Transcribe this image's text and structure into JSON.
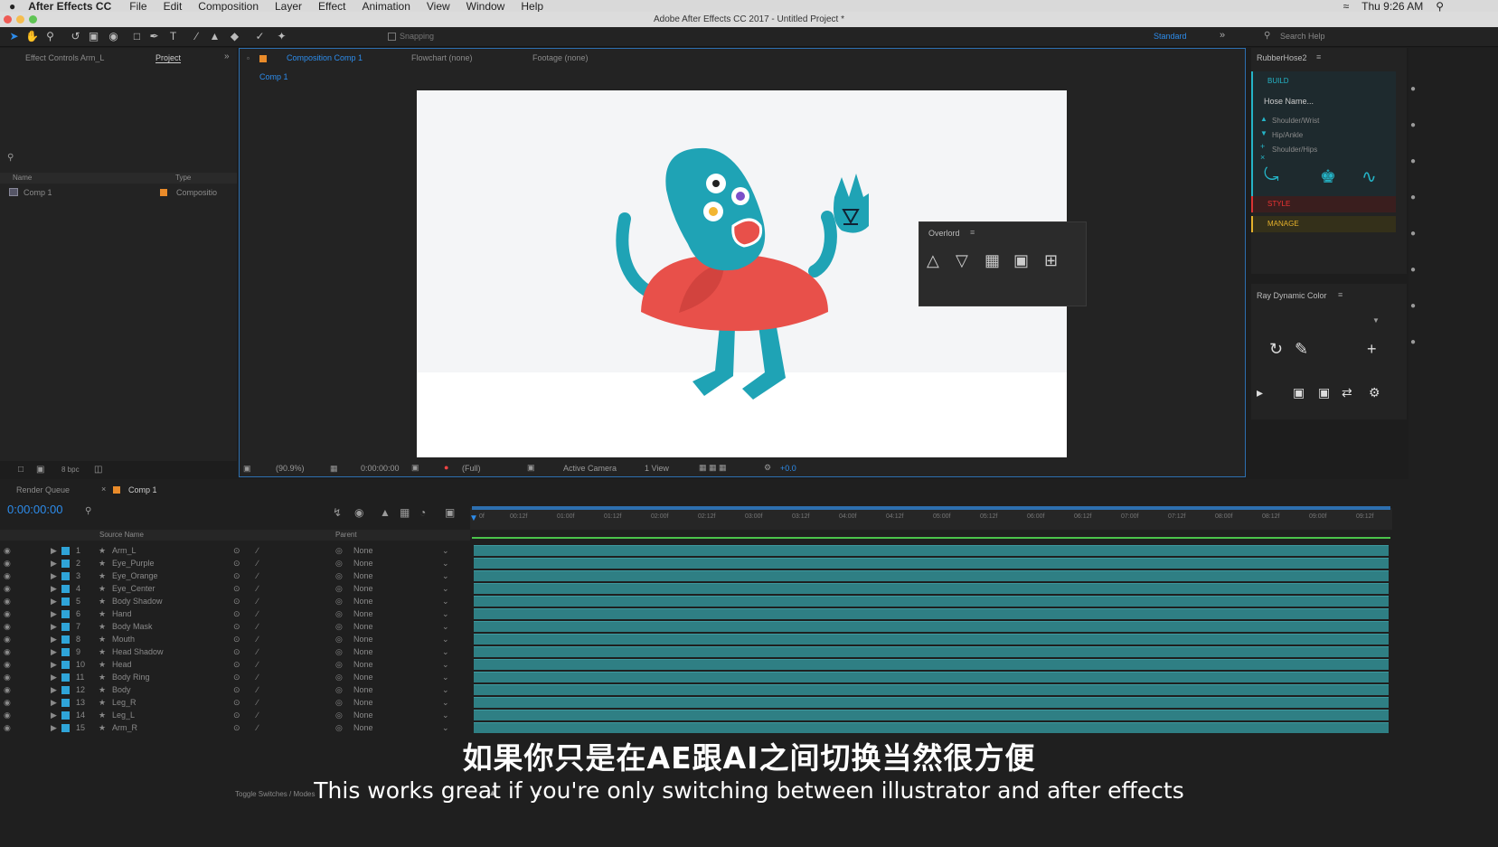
{
  "menu": {
    "apple_icon": "apple-icon",
    "app_name": "After Effects CC",
    "items": [
      "File",
      "Edit",
      "Composition",
      "Layer",
      "Effect",
      "Animation",
      "View",
      "Window",
      "Help"
    ],
    "clock": "Thu 9:26 AM"
  },
  "window": {
    "title": "Adobe After Effects CC 2017 - Untitled Project *"
  },
  "toolbar": {
    "snapping": "Snapping",
    "workspace": "Standard",
    "search_placeholder": "Search Help"
  },
  "left_panel": {
    "tab_effect_controls": "Effect Controls Arm_L",
    "tab_project": "Project",
    "col_name": "Name",
    "col_type": "Type",
    "item_name": "Comp 1",
    "item_type": "Compositio",
    "bpc": "8 bpc"
  },
  "comp_viewer": {
    "tab_composition": "Composition Comp 1",
    "tab_flowchart": "Flowchart (none)",
    "tab_footage": "Footage (none)",
    "breadcrumb": "Comp 1",
    "zoom": "(90.9%)",
    "timecode": "0:00:00:00",
    "resolution": "(Full)",
    "camera": "Active Camera",
    "views": "1 View",
    "exposure": "+0.0"
  },
  "overlord": {
    "title": "Overlord"
  },
  "rubberhose": {
    "title": "RubberHose2",
    "build": "BUILD",
    "hose_name": "Hose Name...",
    "options": [
      "Shoulder/Wrist",
      "Hip/Ankle",
      "Shoulder/Hips"
    ],
    "style": "STYLE",
    "manage": "MANAGE"
  },
  "ray_dynamic": {
    "title": "Ray Dynamic Color"
  },
  "timeline": {
    "tab_render_queue": "Render Queue",
    "tab_comp": "Comp 1",
    "timecode": "0:00:00:00",
    "col_source": "Source Name",
    "col_parent": "Parent",
    "toggle_label": "Toggle Switches / Modes",
    "ruler": [
      "0f",
      "00:12f",
      "01:00f",
      "01:12f",
      "02:00f",
      "02:12f",
      "03:00f",
      "03:12f",
      "04:00f",
      "04:12f",
      "05:00f",
      "05:12f",
      "06:00f",
      "06:12f",
      "07:00f",
      "07:12f",
      "08:00f",
      "08:12f",
      "09:00f",
      "09:12f"
    ],
    "layers": [
      {
        "num": "1",
        "name": "Arm_L",
        "parent": "None"
      },
      {
        "num": "2",
        "name": "Eye_Purple",
        "parent": "None"
      },
      {
        "num": "3",
        "name": "Eye_Orange",
        "parent": "None"
      },
      {
        "num": "4",
        "name": "Eye_Center",
        "parent": "None"
      },
      {
        "num": "5",
        "name": "Body Shadow",
        "parent": "None"
      },
      {
        "num": "6",
        "name": "Hand",
        "parent": "None"
      },
      {
        "num": "7",
        "name": "Body Mask",
        "parent": "None"
      },
      {
        "num": "8",
        "name": "Mouth",
        "parent": "None"
      },
      {
        "num": "9",
        "name": "Head Shadow",
        "parent": "None"
      },
      {
        "num": "10",
        "name": "Head",
        "parent": "None"
      },
      {
        "num": "11",
        "name": "Body Ring",
        "parent": "None"
      },
      {
        "num": "12",
        "name": "Body",
        "parent": "None"
      },
      {
        "num": "13",
        "name": "Leg_R",
        "parent": "None"
      },
      {
        "num": "14",
        "name": "Leg_L",
        "parent": "None"
      },
      {
        "num": "15",
        "name": "Arm_R",
        "parent": "None"
      }
    ]
  },
  "subtitles": {
    "chinese": "如果你只是在AE跟AI之间切换当然很方便",
    "english": "This works great if you're only switching between illustrator and after effects"
  },
  "colors": {
    "accent_blue": "#2d8ceb",
    "character_teal": "#1fa3b5",
    "character_red": "#e8504a",
    "track_teal": "#2f7f84"
  }
}
